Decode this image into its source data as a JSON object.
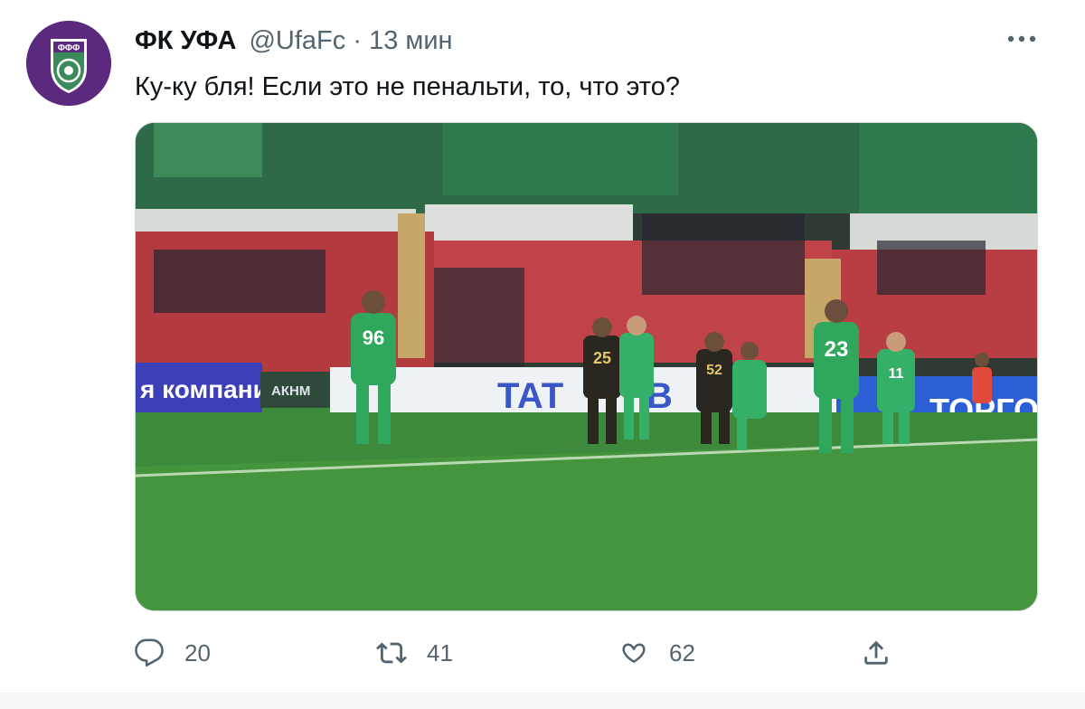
{
  "tweet": {
    "display_name": "ФК УФА",
    "handle": "@UfaFc",
    "separator": "·",
    "time": "13 мин",
    "text": "Ку-ку бля! Если это не пенальти, то, что это?",
    "avatar_label": "ΦΦΦ"
  },
  "media": {
    "board_left": "я компания",
    "board_mid_left": "АКНМ",
    "board_center": "ТАТ",
    "board_center_end": "В",
    "board_right": "ТОРГО",
    "jersey_numbers": [
      "96",
      "25",
      "52",
      "23",
      "11"
    ]
  },
  "actions": {
    "reply_count": "20",
    "retweet_count": "41",
    "like_count": "62"
  },
  "colors": {
    "text_primary": "#0f1419",
    "text_secondary": "#536471",
    "avatar_bg": "#5b2a7e",
    "pitch_green": "#3c8a3a"
  },
  "icons": {
    "reply": "reply-icon",
    "retweet": "retweet-icon",
    "like": "heart-icon",
    "share": "share-icon",
    "more": "more-icon"
  }
}
